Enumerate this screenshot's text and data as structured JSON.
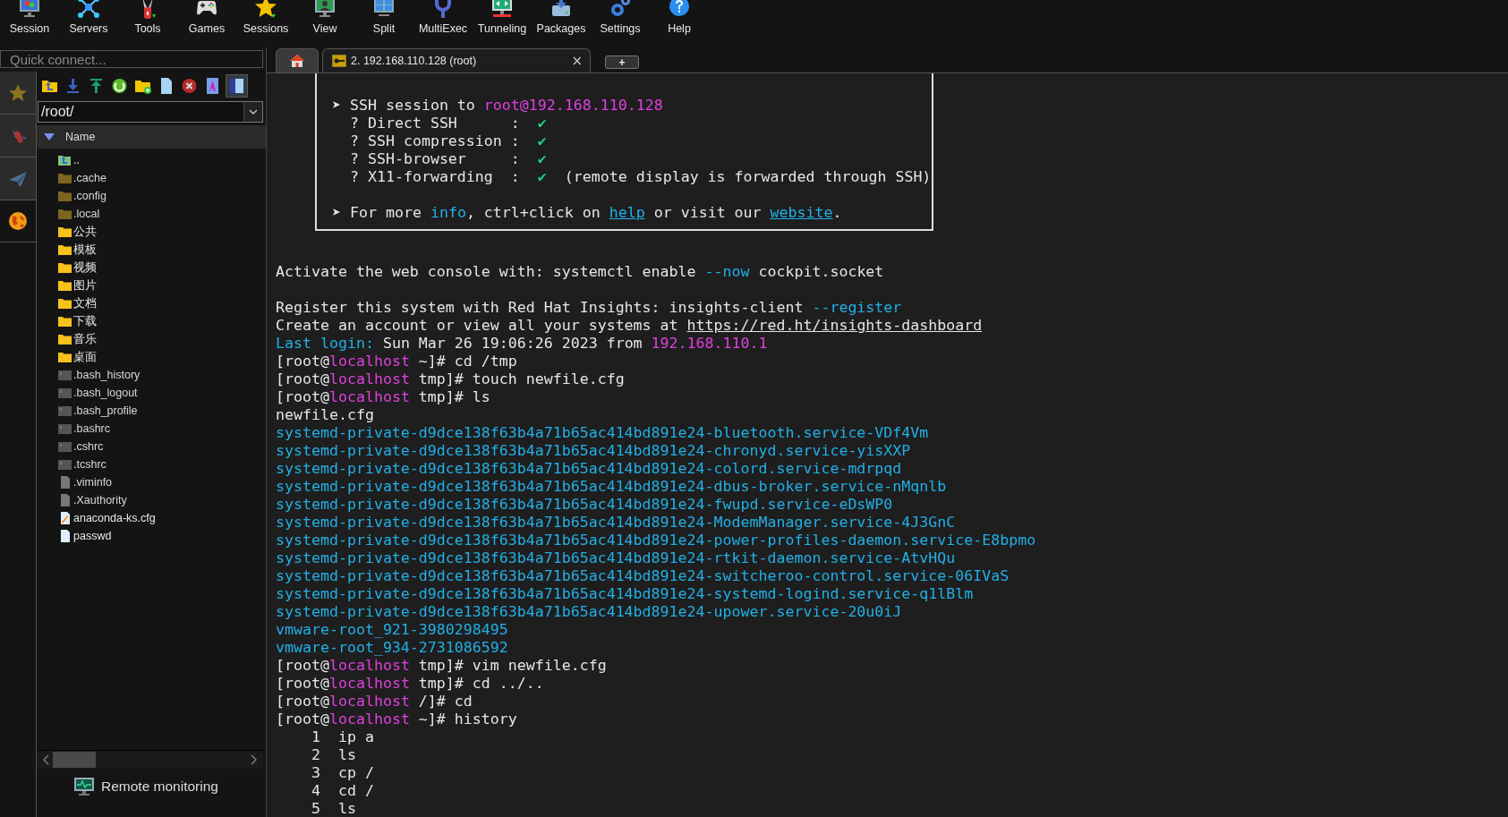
{
  "toolbar": [
    {
      "label": "Session"
    },
    {
      "label": "Servers"
    },
    {
      "label": "Tools"
    },
    {
      "label": "Games"
    },
    {
      "label": "Sessions"
    },
    {
      "label": "View"
    },
    {
      "label": "Split"
    },
    {
      "label": "MultiExec"
    },
    {
      "label": "Tunneling"
    },
    {
      "label": "Packages"
    },
    {
      "label": "Settings"
    },
    {
      "label": "Help"
    }
  ],
  "quick_connect": {
    "placeholder": "Quick connect..."
  },
  "side_tabs": [
    {
      "selected": false
    },
    {
      "selected": false
    },
    {
      "selected": false
    },
    {
      "selected": true
    }
  ],
  "tabs": [
    {
      "kind": "home",
      "selected": false
    },
    {
      "kind": "session",
      "label": "2. 192.168.110.128 (root)",
      "close": "×",
      "selected": true
    }
  ],
  "new_tab": {
    "label": "+"
  },
  "file_browser": {
    "path": "/root/",
    "column": "Name",
    "files": [
      {
        "name": "..",
        "kind": "parent"
      },
      {
        "name": ".cache",
        "kind": "hidden-folder"
      },
      {
        "name": ".config",
        "kind": "hidden-folder"
      },
      {
        "name": ".local",
        "kind": "hidden-folder"
      },
      {
        "name": "公共",
        "kind": "folder"
      },
      {
        "name": "模板",
        "kind": "folder"
      },
      {
        "name": "视频",
        "kind": "folder"
      },
      {
        "name": "图片",
        "kind": "folder"
      },
      {
        "name": "文档",
        "kind": "folder"
      },
      {
        "name": "下载",
        "kind": "folder"
      },
      {
        "name": "音乐",
        "kind": "folder"
      },
      {
        "name": "桌面",
        "kind": "folder"
      },
      {
        "name": ".bash_history",
        "kind": "script"
      },
      {
        "name": ".bash_logout",
        "kind": "script"
      },
      {
        "name": ".bash_profile",
        "kind": "script"
      },
      {
        "name": ".bashrc",
        "kind": "script"
      },
      {
        "name": ".cshrc",
        "kind": "script"
      },
      {
        "name": ".tcshrc",
        "kind": "script"
      },
      {
        "name": ".viminfo",
        "kind": "hidden-file"
      },
      {
        "name": ".Xauthority",
        "kind": "hidden-file"
      },
      {
        "name": "anaconda-ks.cfg",
        "kind": "edit-file"
      },
      {
        "name": "passwd",
        "kind": "file"
      }
    ],
    "remote_monitoring": "Remote monitoring"
  },
  "terminal": {
    "banner": [
      [
        [
          {
            "text": "➤ SSH session to ",
            "kind": "plain"
          },
          {
            "text": "root@192.168.110.128",
            "kind": "highlight"
          }
        ],
        [
          {
            "text": "  ? Direct SSH      :  ",
            "kind": "plain"
          },
          {
            "text": "✔",
            "kind": "check"
          }
        ],
        [
          {
            "text": "  ? SSH compression :  ",
            "kind": "plain"
          },
          {
            "text": "✔",
            "kind": "check"
          }
        ],
        [
          {
            "text": "  ? SSH-browser     :  ",
            "kind": "plain"
          },
          {
            "text": "✔",
            "kind": "check"
          }
        ],
        [
          {
            "text": "  ? X11-forwarding  :  ",
            "kind": "plain"
          },
          {
            "text": "✔",
            "kind": "check"
          },
          {
            "text": "  (remote display is forwarded through SSH)",
            "kind": "plain"
          }
        ]
      ],
      [
        [
          {
            "text": "➤ For more ",
            "kind": "plain"
          },
          {
            "text": "info",
            "kind": "accent"
          },
          {
            "text": ", ctrl+click on ",
            "kind": "plain"
          },
          {
            "text": "help",
            "kind": "link"
          },
          {
            "text": " or visit our ",
            "kind": "plain"
          },
          {
            "text": "website",
            "kind": "link"
          },
          {
            "text": ".",
            "kind": "plain"
          }
        ]
      ]
    ],
    "blocks": [
      [
        [
          {
            "text": "Activate the web console with: systemctl enable ",
            "kind": "plain"
          },
          {
            "text": "--now",
            "kind": "accent"
          },
          {
            "text": " cockpit.socket",
            "kind": "plain"
          }
        ]
      ],
      [
        [
          {
            "text": "Register this system with Red Hat Insights: insights-client ",
            "kind": "plain"
          },
          {
            "text": "--register",
            "kind": "accent"
          }
        ],
        [
          {
            "text": "Create an account or view all your systems at ",
            "kind": "plain"
          },
          {
            "text": "https://red.ht/insights-dashboard",
            "kind": "url"
          }
        ],
        [
          {
            "text": "Last login:",
            "kind": "accent"
          },
          {
            "text": " Sun Mar 26 19:06:26 2023 from ",
            "kind": "plain"
          },
          {
            "text": "192.168.110.1",
            "kind": "highlight"
          }
        ],
        [
          {
            "text": "[root@",
            "kind": "plain"
          },
          {
            "text": "localhost",
            "kind": "highlight"
          },
          {
            "text": " ~]# cd /tmp",
            "kind": "plain"
          }
        ],
        [
          {
            "text": "[root@",
            "kind": "plain"
          },
          {
            "text": "localhost",
            "kind": "highlight"
          },
          {
            "text": " tmp]# touch newfile.cfg",
            "kind": "plain"
          }
        ],
        [
          {
            "text": "[root@",
            "kind": "plain"
          },
          {
            "text": "localhost",
            "kind": "highlight"
          },
          {
            "text": " tmp]# ls",
            "kind": "plain"
          }
        ],
        [
          {
            "text": "newfile.cfg",
            "kind": "plain"
          }
        ],
        [
          {
            "text": "systemd-private-d9dce138f63b4a71b65ac414bd891e24-bluetooth.service-VDf4Vm",
            "kind": "accent"
          }
        ],
        [
          {
            "text": "systemd-private-d9dce138f63b4a71b65ac414bd891e24-chronyd.service-yisXXP",
            "kind": "accent"
          }
        ],
        [
          {
            "text": "systemd-private-d9dce138f63b4a71b65ac414bd891e24-colord.service-mdrpqd",
            "kind": "accent"
          }
        ],
        [
          {
            "text": "systemd-private-d9dce138f63b4a71b65ac414bd891e24-dbus-broker.service-nMqnlb",
            "kind": "accent"
          }
        ],
        [
          {
            "text": "systemd-private-d9dce138f63b4a71b65ac414bd891e24-fwupd.service-eDsWP0",
            "kind": "accent"
          }
        ],
        [
          {
            "text": "systemd-private-d9dce138f63b4a71b65ac414bd891e24-ModemManager.service-4J3GnC",
            "kind": "accent"
          }
        ],
        [
          {
            "text": "systemd-private-d9dce138f63b4a71b65ac414bd891e24-power-profiles-daemon.service-E8bpmo",
            "kind": "accent"
          }
        ],
        [
          {
            "text": "systemd-private-d9dce138f63b4a71b65ac414bd891e24-rtkit-daemon.service-AtvHQu",
            "kind": "accent"
          }
        ],
        [
          {
            "text": "systemd-private-d9dce138f63b4a71b65ac414bd891e24-switcheroo-control.service-06IVaS",
            "kind": "accent"
          }
        ],
        [
          {
            "text": "systemd-private-d9dce138f63b4a71b65ac414bd891e24-systemd-logind.service-q1lBlm",
            "kind": "accent"
          }
        ],
        [
          {
            "text": "systemd-private-d9dce138f63b4a71b65ac414bd891e24-upower.service-20u0iJ",
            "kind": "accent"
          }
        ],
        [
          {
            "text": "vmware-root_921-3980298495",
            "kind": "accent"
          }
        ],
        [
          {
            "text": "vmware-root_934-2731086592",
            "kind": "accent"
          }
        ],
        [
          {
            "text": "[root@",
            "kind": "plain"
          },
          {
            "text": "localhost",
            "kind": "highlight"
          },
          {
            "text": " tmp]# vim newfile.cfg",
            "kind": "plain"
          }
        ],
        [
          {
            "text": "[root@",
            "kind": "plain"
          },
          {
            "text": "localhost",
            "kind": "highlight"
          },
          {
            "text": " tmp]# cd ../..",
            "kind": "plain"
          }
        ],
        [
          {
            "text": "[root@",
            "kind": "plain"
          },
          {
            "text": "localhost",
            "kind": "highlight"
          },
          {
            "text": " /]# cd",
            "kind": "plain"
          }
        ],
        [
          {
            "text": "[root@",
            "kind": "plain"
          },
          {
            "text": "localhost",
            "kind": "highlight"
          },
          {
            "text": " ~]# history",
            "kind": "plain"
          }
        ],
        [
          {
            "text": "    1  ip a",
            "kind": "plain"
          }
        ],
        [
          {
            "text": "    2  ls",
            "kind": "plain"
          }
        ],
        [
          {
            "text": "    3  cp /",
            "kind": "plain"
          }
        ],
        [
          {
            "text": "    4  cd /",
            "kind": "plain"
          }
        ],
        [
          {
            "text": "    5  ls",
            "kind": "plain"
          }
        ]
      ]
    ]
  }
}
